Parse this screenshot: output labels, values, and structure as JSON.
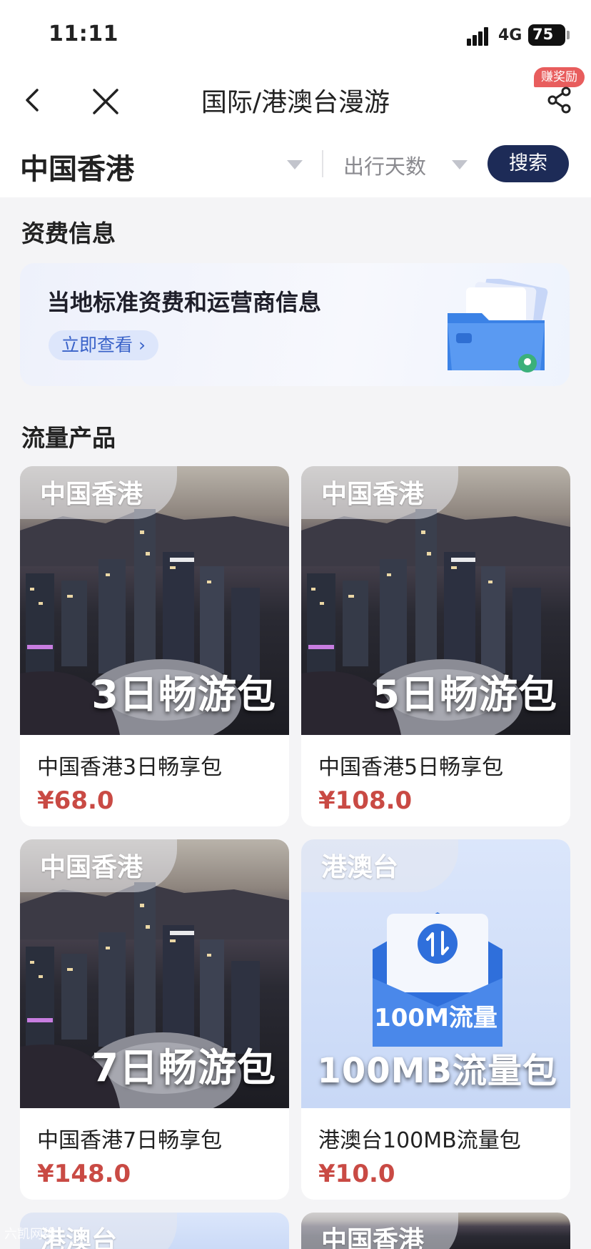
{
  "status": {
    "time": "11:11",
    "network": "4G",
    "battery": "75"
  },
  "nav": {
    "title": "国际/港澳台漫游",
    "reward_badge": "赚奖励"
  },
  "search": {
    "region": "中国香港",
    "days_placeholder": "出行天数",
    "button": "搜索"
  },
  "fee_section": {
    "title": "资费信息",
    "card_title": "当地标准资费和运营商信息",
    "card_button": "立即查看 ›"
  },
  "products_section": {
    "title": "流量产品"
  },
  "products": [
    {
      "tag": "中国香港",
      "banner": "3日畅游包",
      "name": "中国香港3日畅享包",
      "price": "¥68.0"
    },
    {
      "tag": "中国香港",
      "banner": "5日畅游包",
      "name": "中国香港5日畅享包",
      "price": "¥108.0"
    },
    {
      "tag": "中国香港",
      "banner": "7日畅游包",
      "name": "中国香港7日畅享包",
      "price": "¥148.0"
    },
    {
      "tag": "港澳台",
      "banner": "100MB流量包",
      "envelope_label": "100M流量",
      "name": "港澳台100MB流量包",
      "price": "¥10.0"
    },
    {
      "tag": "港澳台"
    },
    {
      "tag": "中国香港"
    }
  ],
  "watermark": "六凯网络",
  "colors": {
    "primary_button": "#1d2b57",
    "price": "#c94a44",
    "reward": "#e85d5d",
    "link": "#3a63c9"
  }
}
